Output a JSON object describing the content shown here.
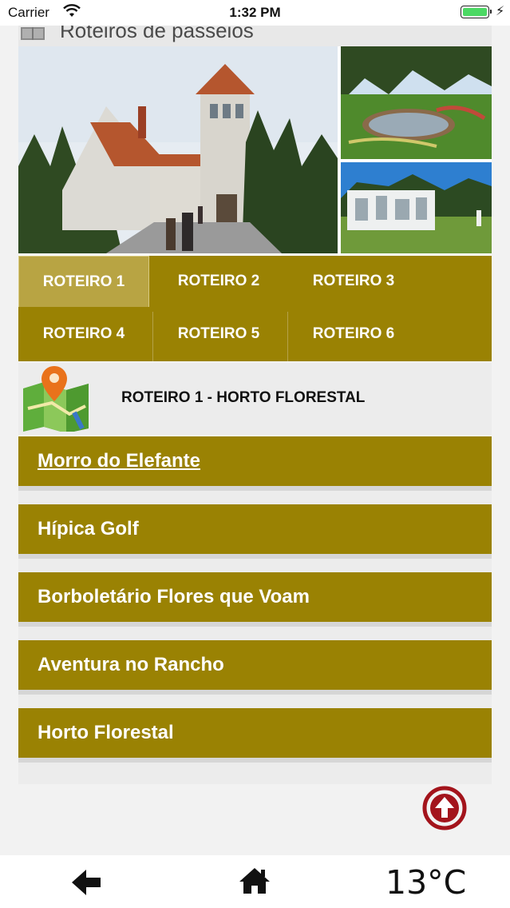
{
  "status_bar": {
    "carrier": "Carrier",
    "time": "1:32 PM",
    "battery_color": "#4cd964"
  },
  "header": {
    "title": "Roteiros de passeios",
    "icon": "map-book-icon"
  },
  "tabs": [
    {
      "label": "ROTEIRO 1",
      "active": true
    },
    {
      "label": "ROTEIRO 2",
      "active": false
    },
    {
      "label": "ROTEIRO 3",
      "active": false
    },
    {
      "label": "ROTEIRO 4",
      "active": false
    },
    {
      "label": "ROTEIRO 5",
      "active": false
    },
    {
      "label": "ROTEIRO 6",
      "active": false
    }
  ],
  "route": {
    "title": "ROTEIRO 1 - HORTO FLORESTAL",
    "icon": "map-pin-icon"
  },
  "places": [
    {
      "label": "Morro do Elefante"
    },
    {
      "label": "Hípica Golf"
    },
    {
      "label": "Borboletário Flores que Voam"
    },
    {
      "label": "Aventura no Rancho"
    },
    {
      "label": "Horto Florestal"
    }
  ],
  "bottom_bar": {
    "temperature": "13°C",
    "back_icon": "back-arrow-icon",
    "home_icon": "home-icon"
  },
  "colors": {
    "accent": "#9a8203",
    "accent_active": "#b8a443",
    "scroll_top": "#a3141c"
  }
}
